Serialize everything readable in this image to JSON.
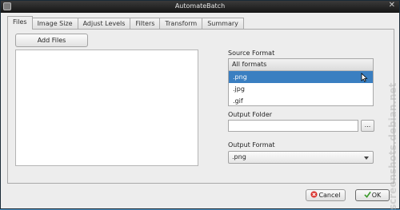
{
  "window": {
    "title": "AutomateBatch",
    "close_glyph": "✕"
  },
  "tabs": [
    {
      "label": "Files",
      "active": true
    },
    {
      "label": "Image Size"
    },
    {
      "label": "Adjust Levels"
    },
    {
      "label": "Filters"
    },
    {
      "label": "Transform"
    },
    {
      "label": "Summary"
    }
  ],
  "files": {
    "add_files_label": "Add Files",
    "list_items": []
  },
  "source_format": {
    "label": "Source Format",
    "header": "All formats",
    "options": [
      ".png",
      ".jpg",
      ".gif"
    ],
    "selected": ".png"
  },
  "output_folder": {
    "label": "Output Folder",
    "value": "",
    "browse_label": "..."
  },
  "output_format": {
    "label": "Output Format",
    "value": ".png"
  },
  "footer": {
    "cancel_label": "Cancel",
    "ok_label": "OK"
  },
  "watermark": {
    "text": "screenshots.debian.net"
  },
  "colors": {
    "selection": "#3a7fc1",
    "titlebar": "#1f1f1f",
    "background": "#ededed"
  }
}
